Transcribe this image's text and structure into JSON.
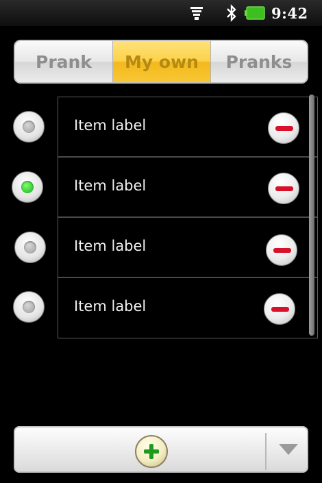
{
  "status_bar": {
    "time": "9:42",
    "icons": [
      "wifi-icon",
      "bluetooth-icon",
      "battery-icon"
    ]
  },
  "tabs": [
    {
      "label": "Prank",
      "selected": false
    },
    {
      "label": "My own",
      "selected": true
    },
    {
      "label": "Pranks",
      "selected": false
    }
  ],
  "list": {
    "items": [
      {
        "label": "Item label",
        "selected": false
      },
      {
        "label": "Item label",
        "selected": true
      },
      {
        "label": "Item label",
        "selected": false
      },
      {
        "label": "Item label",
        "selected": false
      }
    ]
  },
  "bottom_bar": {
    "add_icon": "plus-icon",
    "dropdown_icon": "triangle-down-icon"
  },
  "colors": {
    "selected_tab": "#f8c836",
    "remove": "#d8102a",
    "add": "#1e9a1e",
    "radio_checked": "#16b21b"
  }
}
